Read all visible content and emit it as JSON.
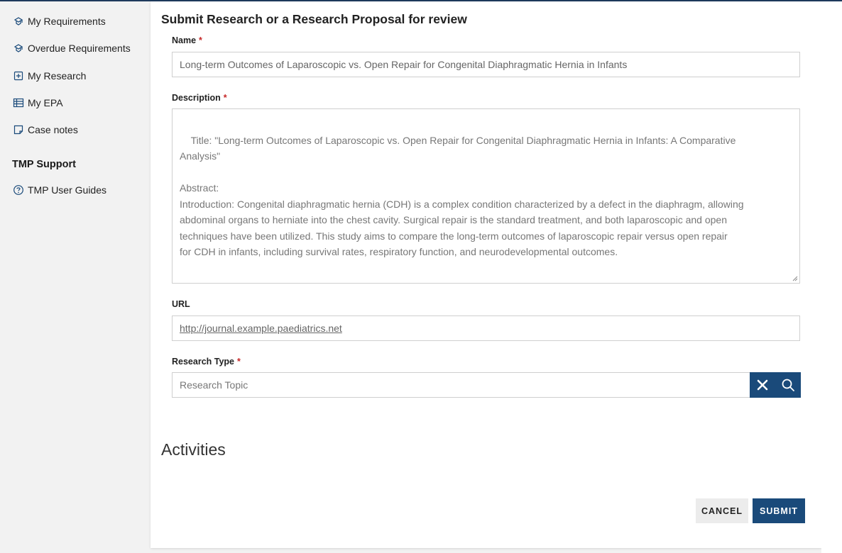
{
  "sidebar": {
    "items": [
      {
        "label": "My Requirements",
        "icon": "requirements-icon"
      },
      {
        "label": "Overdue Requirements",
        "icon": "requirements-icon"
      },
      {
        "label": "My Research",
        "icon": "add-box-icon"
      },
      {
        "label": "My EPA",
        "icon": "table-icon"
      },
      {
        "label": "Case notes",
        "icon": "note-icon"
      }
    ],
    "support_heading": "TMP Support",
    "support_items": [
      {
        "label": "TMP User Guides",
        "icon": "help-circle-icon"
      }
    ]
  },
  "form": {
    "title": "Submit Research or a Research Proposal for review",
    "name": {
      "label": "Name",
      "required_mark": "*",
      "value": "Long-term Outcomes of Laparoscopic vs. Open Repair for Congenital Diaphragmatic Hernia in Infants"
    },
    "description": {
      "label": "Description",
      "required_mark": "*",
      "value": "Title: \"Long-term Outcomes of Laparoscopic vs. Open Repair for Congenital Diaphragmatic Hernia in Infants: A Comparative\nAnalysis\"\n\nAbstract:\nIntroduction: Congenital diaphragmatic hernia (CDH) is a complex condition characterized by a defect in the diaphragm, allowing\nabdominal organs to herniate into the chest cavity. Surgical repair is the standard treatment, and both laparoscopic and open\ntechniques have been utilized. This study aims to compare the long-term outcomes of laparoscopic repair versus open repair\nfor CDH in infants, including survival rates, respiratory function, and neurodevelopmental outcomes."
    },
    "url": {
      "label": "URL",
      "value": "http://journal.example.paediatrics.net"
    },
    "research_type": {
      "label": "Research Type",
      "required_mark": "*",
      "value": "Research Topic"
    }
  },
  "activities": {
    "title": "Activities"
  },
  "actions": {
    "cancel_label": "CANCEL",
    "submit_label": "SUBMIT"
  },
  "colors": {
    "primary": "#1a4a7a",
    "required": "#c62828",
    "sidebar_bg": "#f2f2f2",
    "icon": "#1a4a7a"
  }
}
